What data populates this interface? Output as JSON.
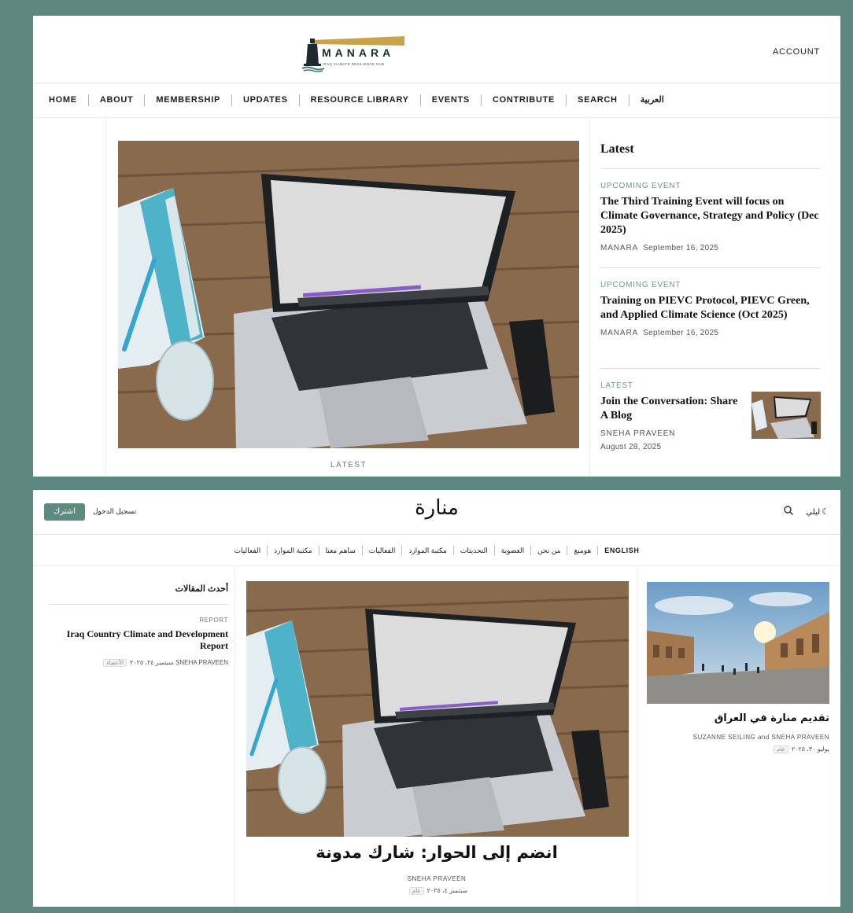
{
  "colors": {
    "frame": "#5e8780",
    "accent": "#5e8b80",
    "kicker": "#6f9590"
  },
  "english_site": {
    "logo": {
      "wordmark": "MANARA",
      "tagline": "IRAQ CLIMATE RESILIENCE HUB"
    },
    "account_label": "ACCOUNT",
    "nav": [
      "HOME",
      "ABOUT",
      "MEMBERSHIP",
      "UPDATES",
      "RESOURCE LIBRARY",
      "EVENTS",
      "CONTRIBUTE",
      "SEARCH",
      "العربية"
    ],
    "hero_kicker": "LATEST",
    "sidebar": {
      "heading": "Latest",
      "items": [
        {
          "kicker": "UPCOMING EVENT",
          "title": "The Third Training Event will focus on Climate Governance, Strategy and Policy (Dec 2025)",
          "author": "MANARA",
          "date": "September 16, 2025"
        },
        {
          "kicker": "UPCOMING EVENT",
          "title": "Training on PIEVC Protocol, PIEVC Green, and Applied Climate Science (Oct 2025)",
          "author": "MANARA",
          "date": "September 16, 2025"
        },
        {
          "kicker": "LATEST",
          "title": "Join the Conversation: Share A Blog",
          "author": "SNEHA PRAVEEN",
          "date": "August 28, 2025"
        }
      ]
    }
  },
  "arabic_site": {
    "subscribe_label": "اشترك",
    "login_label": "تسجيل الدخول",
    "brand": "منارة",
    "night_label": "ليلي",
    "nav": [
      "ENGLISH",
      "هومبغ",
      "من نحن",
      "العضوية",
      "التحديثات",
      "مكتبة الموارد",
      "الفعاليات",
      "ساهم معنا",
      "مكتبة الموارد",
      "الفعاليات"
    ],
    "left": {
      "heading": "أحدث المقالات",
      "kicker": "REPORT",
      "title": "Iraq Country Climate and Development Report",
      "author": "SNEHA PRAVEEN",
      "date": "سبتمبر ٢٤، ٢٠٢٥",
      "badge": "الأعضاء"
    },
    "center": {
      "title": "انضم إلى الحوار: شارك مدونة",
      "author": "SNEHA PRAVEEN",
      "date": "سبتمبر ٤، ٢٠٢٥",
      "badge": "عام"
    },
    "right": {
      "title": "تقديم منارة في العراق",
      "author": "SUZANNE SEILING and SNEHA PRAVEEN",
      "date": "يوليو ٣٠، ٢٠٢٥",
      "badge": "عام"
    }
  }
}
